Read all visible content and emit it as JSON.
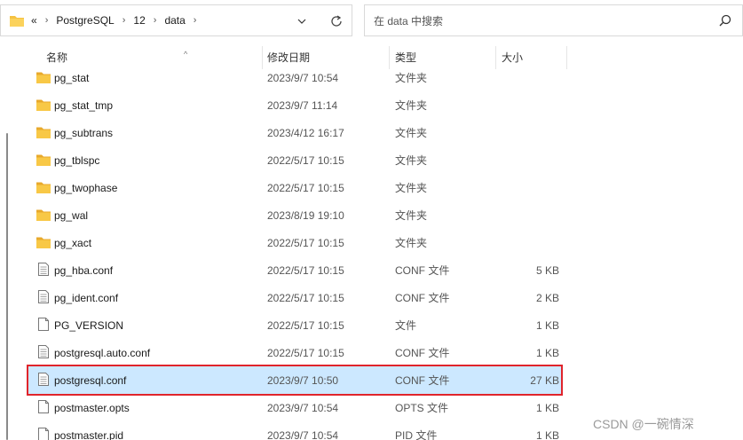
{
  "address_bar": {
    "overflow": "«",
    "crumbs": [
      "PostgreSQL",
      "12",
      "data"
    ]
  },
  "search": {
    "placeholder": "在 data 中搜索"
  },
  "columns": {
    "name": "名称",
    "date": "修改日期",
    "type": "类型",
    "size": "大小"
  },
  "files": [
    {
      "name": "pg_stat",
      "date": "2023/9/7 10:54",
      "type": "文件夹",
      "size": "",
      "icon": "folder"
    },
    {
      "name": "pg_stat_tmp",
      "date": "2023/9/7 11:14",
      "type": "文件夹",
      "size": "",
      "icon": "folder"
    },
    {
      "name": "pg_subtrans",
      "date": "2023/4/12 16:17",
      "type": "文件夹",
      "size": "",
      "icon": "folder"
    },
    {
      "name": "pg_tblspc",
      "date": "2022/5/17 10:15",
      "type": "文件夹",
      "size": "",
      "icon": "folder"
    },
    {
      "name": "pg_twophase",
      "date": "2022/5/17 10:15",
      "type": "文件夹",
      "size": "",
      "icon": "folder"
    },
    {
      "name": "pg_wal",
      "date": "2023/8/19 19:10",
      "type": "文件夹",
      "size": "",
      "icon": "folder"
    },
    {
      "name": "pg_xact",
      "date": "2022/5/17 10:15",
      "type": "文件夹",
      "size": "",
      "icon": "folder"
    },
    {
      "name": "pg_hba.conf",
      "date": "2022/5/17 10:15",
      "type": "CONF 文件",
      "size": "5 KB",
      "icon": "doc-lines"
    },
    {
      "name": "pg_ident.conf",
      "date": "2022/5/17 10:15",
      "type": "CONF 文件",
      "size": "2 KB",
      "icon": "doc-lines"
    },
    {
      "name": "PG_VERSION",
      "date": "2022/5/17 10:15",
      "type": "文件",
      "size": "1 KB",
      "icon": "doc-blank"
    },
    {
      "name": "postgresql.auto.conf",
      "date": "2022/5/17 10:15",
      "type": "CONF 文件",
      "size": "1 KB",
      "icon": "doc-lines"
    },
    {
      "name": "postgresql.conf",
      "date": "2023/9/7 10:50",
      "type": "CONF 文件",
      "size": "27 KB",
      "icon": "doc-lines",
      "selected": true
    },
    {
      "name": "postmaster.opts",
      "date": "2023/9/7 10:54",
      "type": "OPTS 文件",
      "size": "1 KB",
      "icon": "doc-blank"
    },
    {
      "name": "postmaster.pid",
      "date": "2023/9/7 10:54",
      "type": "PID 文件",
      "size": "1 KB",
      "icon": "doc-blank"
    }
  ],
  "watermark": "CSDN @一碗情深",
  "colors": {
    "folder": "#f5c242",
    "selection": "#cce8ff",
    "highlight_border": "#e0242b"
  }
}
